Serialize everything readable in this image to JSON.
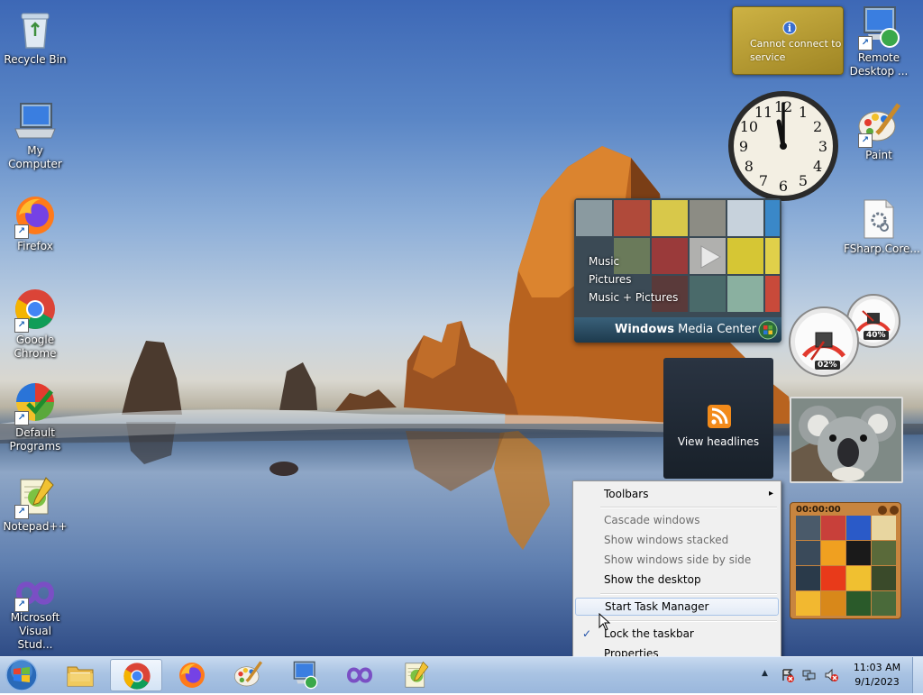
{
  "desktop_icons": [
    {
      "label": "Recycle Bin"
    },
    {
      "label": "My Computer"
    },
    {
      "label": "Firefox"
    },
    {
      "label": "Google Chrome"
    },
    {
      "label": "Default Programs"
    },
    {
      "label": "Notepad++"
    },
    {
      "label": "Microsoft Visual Stud..."
    },
    {
      "label": "Remote Desktop ..."
    },
    {
      "label": "Paint"
    },
    {
      "label": "FSharp.Core..."
    }
  ],
  "gadgets": {
    "weather": {
      "message": "Cannot connect to service"
    },
    "clock": {
      "numerals": [
        "12",
        "1",
        "2",
        "3",
        "4",
        "5",
        "6",
        "7",
        "8",
        "9",
        "10",
        "11"
      ]
    },
    "media_center": {
      "menu": [
        "Music",
        "Pictures",
        "Music + Pictures"
      ],
      "brand_bold": "Windows",
      "brand_rest": " Media Center"
    },
    "cpu_meter": {
      "cpu_percent": "02%",
      "memory_percent": "40%"
    },
    "rss": {
      "label": "View headlines"
    },
    "puzzle": {
      "timer": "00:00:00"
    }
  },
  "context_menu": {
    "toolbars": "Toolbars",
    "cascade": "Cascade windows",
    "stacked": "Show windows stacked",
    "side_by_side": "Show windows side by side",
    "show_desktop": "Show the desktop",
    "task_manager": "Start Task Manager",
    "lock_taskbar": "Lock the taskbar",
    "lock_checkmark": "✓",
    "properties": "Properties",
    "submenu_arrow": "▸"
  },
  "taskbar": {
    "pinned": [
      "Windows Explorer",
      "Google Chrome",
      "Firefox",
      "Paint",
      "Remote Desktop Connection",
      "Microsoft Visual Studio",
      "Notepad++"
    ],
    "clock_time": "11:03 AM",
    "clock_date": "9/1/2023",
    "tray_arrow": "▲"
  }
}
